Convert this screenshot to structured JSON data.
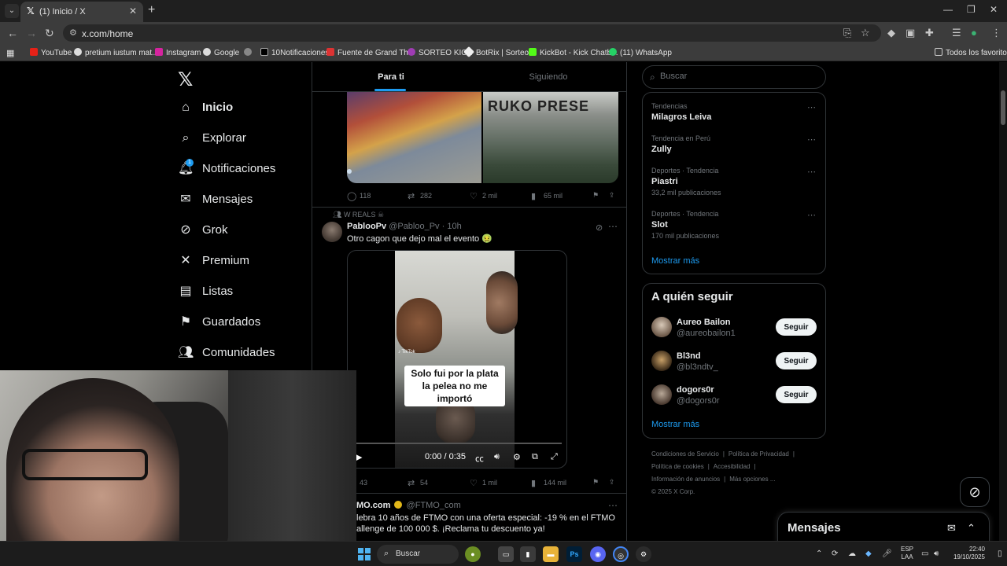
{
  "browser": {
    "tab_title": "(1) Inicio / X",
    "url": "x.com/home",
    "bookmarks": [
      "YouTube",
      "pretium iustum mat...",
      "Instagram",
      "Google",
      "10Notificaciones",
      "Fuente de Grand Th...",
      "SORTEO KICK",
      "BotRix | Sorteos",
      "KickBot - Kick Chatb...",
      "(11) WhatsApp"
    ],
    "all_bookmarks": "Todos los favoritos"
  },
  "nav": {
    "items": [
      {
        "label": "Inicio",
        "icon": "home-icon"
      },
      {
        "label": "Explorar",
        "icon": "search-icon"
      },
      {
        "label": "Notificaciones",
        "icon": "bell-icon",
        "badge": "1"
      },
      {
        "label": "Mensajes",
        "icon": "envelope-icon"
      },
      {
        "label": "Grok",
        "icon": "grok-icon"
      },
      {
        "label": "Premium",
        "icon": "x-icon"
      },
      {
        "label": "Listas",
        "icon": "list-icon"
      },
      {
        "label": "Guardados",
        "icon": "bookmark-icon"
      },
      {
        "label": "Comunidades",
        "icon": "people-icon"
      }
    ]
  },
  "timeline": {
    "tabs": [
      "Para ti",
      "Siguiendo"
    ],
    "post1": {
      "image_text": "RUKO PRESE",
      "replies": "118",
      "reposts": "282",
      "likes": "2 mil",
      "views": "65 mil"
    },
    "post2": {
      "context": "W REALS ☠",
      "name": "PablooPv",
      "handle": "@Pabloo_Pv",
      "time": "· 10h",
      "text": "Otro cagon que dejo mal el evento 🤢",
      "video_caption": "Solo fui por la plata la pelea no me importó",
      "video_time": "0:00 / 0:35",
      "replies": "43",
      "reposts": "54",
      "likes": "1 mil",
      "views": "144 mil"
    },
    "post3": {
      "name": "MO.com",
      "handle": "@FTMO_com",
      "line1": "lebra 10 años de FTMO con una oferta especial: -19 % en el FTMO",
      "line2": "allenge de 100 000 $. ¡Reclama tu descuento ya!"
    }
  },
  "sidebar_right": {
    "search_placeholder": "Buscar",
    "trends": [
      {
        "category": "Tendencias",
        "name": "Milagros Leiva",
        "count": ""
      },
      {
        "category": "Tendencia en Perú",
        "name": "Zully",
        "count": ""
      },
      {
        "category": "Deportes · Tendencia",
        "name": "Piastri",
        "count": "33,2 mil publicaciones"
      },
      {
        "category": "Deportes · Tendencia",
        "name": "Slot",
        "count": "170 mil publicaciones"
      }
    ],
    "trends_show_more": "Mostrar más",
    "who_to_follow_title": "A quién seguir",
    "follow": [
      {
        "name": "Aureo Bailon",
        "handle": "@aureobailon1",
        "button": "Seguir"
      },
      {
        "name": "Bl3nd",
        "handle": "@bl3ndtv_",
        "button": "Seguir"
      },
      {
        "name": "dogors0r",
        "handle": "@dogors0r",
        "button": "Seguir"
      }
    ],
    "follow_show_more": "Mostrar más",
    "footer": {
      "terms": "Condiciones de Servicio",
      "privacy": "Política de Privacidad",
      "cookies": "Política de cookies",
      "accessibility": "Accesibilidad",
      "ads": "Información de anuncios",
      "more": "Más opciones ...",
      "copyright": "© 2025 X Corp."
    }
  },
  "messages_drawer": {
    "title": "Mensajes"
  },
  "taskbar": {
    "search": "Buscar",
    "lang1": "ESP",
    "lang2": "LAA",
    "time": "22:40",
    "date": "19/10/2025"
  }
}
